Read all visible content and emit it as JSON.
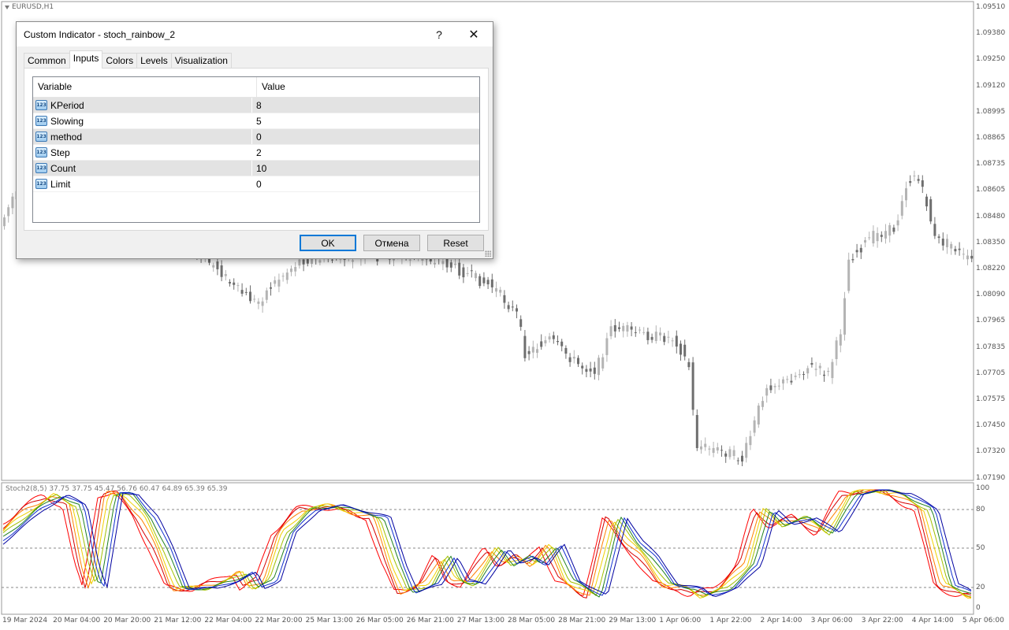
{
  "chart": {
    "symbol_label": "EURUSD,H1",
    "indicator_label": "Stoch2(8,5) 37.75 37.75 45.47 56.76 60.47 64.89 65.39 65.39",
    "price_labels": [
      "1.09510",
      "1.09380",
      "1.09250",
      "1.09120",
      "1.08995",
      "1.08865",
      "1.08735",
      "1.08605",
      "1.08480",
      "1.08350",
      "1.08220",
      "1.08090",
      "1.07965",
      "1.07835",
      "1.07705",
      "1.07575",
      "1.07450",
      "1.07320",
      "1.07190"
    ],
    "osc_labels": [
      "100",
      "80",
      "50",
      "20",
      "0"
    ],
    "date_labels": [
      "19 Mar 2024",
      "20 Mar 04:00",
      "20 Mar 20:00",
      "21 Mar 12:00",
      "22 Mar 04:00",
      "22 Mar 20:00",
      "25 Mar 13:00",
      "26 Mar 05:00",
      "26 Mar 21:00",
      "27 Mar 13:00",
      "28 Mar 05:00",
      "28 Mar 21:00",
      "29 Mar 13:00",
      "1 Apr 06:00",
      "1 Apr 22:00",
      "2 Apr 14:00",
      "3 Apr 06:00",
      "3 Apr 22:00",
      "4 Apr 14:00",
      "5 Apr 06:00"
    ],
    "colors": {
      "bull": "#b4b4b4",
      "bear": "#6e6e6e",
      "osc": [
        "#ff0000",
        "#d40000",
        "#ff8000",
        "#f0d000",
        "#a0c000",
        "#208020",
        "#1030d0",
        "#0000a0"
      ]
    }
  },
  "dialog": {
    "title": "Custom Indicator - stoch_rainbow_2",
    "help": "?",
    "close": "✕",
    "tabs": [
      "Common",
      "Inputs",
      "Colors",
      "Levels",
      "Visualization"
    ],
    "active_tab": "Inputs",
    "headers": {
      "variable": "Variable",
      "value": "Value"
    },
    "icon_text": "123",
    "rows": [
      {
        "name": "KPeriod",
        "value": "8"
      },
      {
        "name": "Slowing",
        "value": "5"
      },
      {
        "name": "method",
        "value": "0"
      },
      {
        "name": "Step",
        "value": "2"
      },
      {
        "name": "Count",
        "value": "10"
      },
      {
        "name": "Limit",
        "value": "0"
      }
    ],
    "buttons": {
      "ok": "OK",
      "cancel": "Отмена",
      "reset": "Reset"
    }
  }
}
